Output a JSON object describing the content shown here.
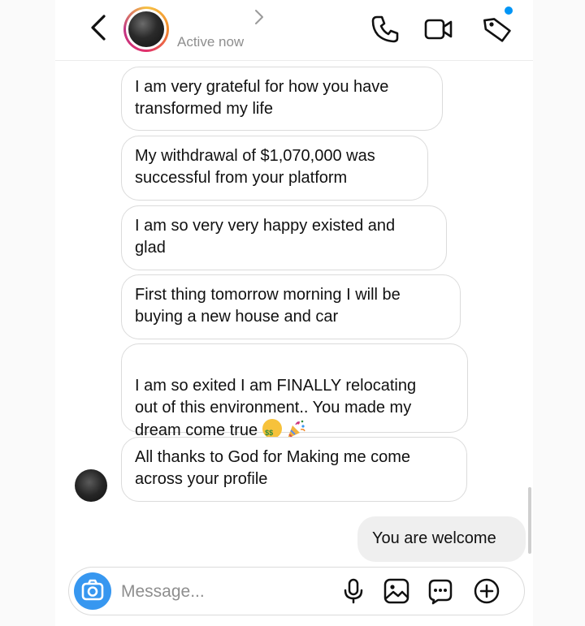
{
  "header": {
    "status": "Active now"
  },
  "messages": [
    {
      "from": "them",
      "text": "I am very grateful for how you have\ntransformed my life"
    },
    {
      "from": "them",
      "text": "My withdrawal of $1,070,000 was\nsuccessful from your platform"
    },
    {
      "from": "them",
      "text": "I am so very very happy existed and\nglad"
    },
    {
      "from": "them",
      "text": "First thing tomorrow morning I will be\nbuying a new house and car"
    },
    {
      "from": "them",
      "text": "I am so exited I am FINALLY relocating\nout of this environment.. You made my\ndream come true"
    },
    {
      "from": "them",
      "text": "All thanks to God for Making me come\nacross your profile"
    },
    {
      "from": "me",
      "text": "You are welcome"
    }
  ],
  "composer": {
    "placeholder": "Message..."
  },
  "icons": {
    "back": "chevron-left-icon",
    "profile_link": "chevron-right-icon",
    "call": "phone-icon",
    "video": "video-camera-icon",
    "tag": "tag-icon",
    "camera": "camera-icon",
    "mic": "microphone-icon",
    "gallery": "image-icon",
    "sticker": "chat-sticker-icon",
    "add": "plus-circle-icon",
    "emoji_1": "money-mouth-face-emoji",
    "emoji_2": "party-popper-emoji"
  },
  "colors": {
    "accent": "#3797f0",
    "notification": "#0095f6",
    "sent_bubble": "#efefef",
    "status_text": "#8e8e8e"
  }
}
